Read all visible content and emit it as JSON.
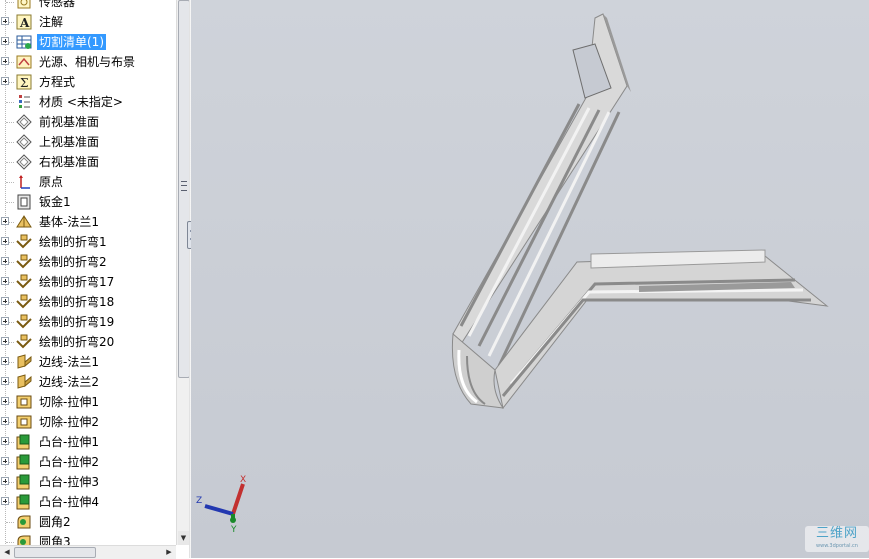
{
  "feature_tree": {
    "items": [
      {
        "label": "传感器",
        "icon": "sensor-icon",
        "expandable": false
      },
      {
        "label": "注解",
        "icon": "annotation-icon",
        "expandable": true
      },
      {
        "label": "切割清单(1)",
        "icon": "cut-list-icon",
        "expandable": true,
        "selected": true
      },
      {
        "label": "光源、相机与布景",
        "icon": "lights-cameras-icon",
        "expandable": true
      },
      {
        "label": "方程式",
        "icon": "equations-icon",
        "expandable": true
      },
      {
        "label": "材质 <未指定>",
        "icon": "material-icon",
        "expandable": false
      },
      {
        "label": "前视基准面",
        "icon": "plane-icon",
        "expandable": false
      },
      {
        "label": "上视基准面",
        "icon": "plane-icon",
        "expandable": false
      },
      {
        "label": "右视基准面",
        "icon": "plane-icon",
        "expandable": false
      },
      {
        "label": "原点",
        "icon": "origin-icon",
        "expandable": false
      },
      {
        "label": "钣金1",
        "icon": "sheet-metal-icon",
        "expandable": false
      },
      {
        "label": "基体-法兰1",
        "icon": "base-flange-icon",
        "expandable": true
      },
      {
        "label": "绘制的折弯1",
        "icon": "sketched-bend-icon",
        "expandable": true
      },
      {
        "label": "绘制的折弯2",
        "icon": "sketched-bend-icon",
        "expandable": true
      },
      {
        "label": "绘制的折弯17",
        "icon": "sketched-bend-icon",
        "expandable": true
      },
      {
        "label": "绘制的折弯18",
        "icon": "sketched-bend-icon",
        "expandable": true
      },
      {
        "label": "绘制的折弯19",
        "icon": "sketched-bend-icon",
        "expandable": true
      },
      {
        "label": "绘制的折弯20",
        "icon": "sketched-bend-icon",
        "expandable": true
      },
      {
        "label": "边线-法兰1",
        "icon": "edge-flange-icon",
        "expandable": true
      },
      {
        "label": "边线-法兰2",
        "icon": "edge-flange-icon",
        "expandable": true
      },
      {
        "label": "切除-拉伸1",
        "icon": "cut-extrude-icon",
        "expandable": true
      },
      {
        "label": "切除-拉伸2",
        "icon": "cut-extrude-icon",
        "expandable": true
      },
      {
        "label": "凸台-拉伸1",
        "icon": "boss-extrude-icon",
        "expandable": true
      },
      {
        "label": "凸台-拉伸2",
        "icon": "boss-extrude-icon",
        "expandable": true
      },
      {
        "label": "凸台-拉伸3",
        "icon": "boss-extrude-icon",
        "expandable": true
      },
      {
        "label": "凸台-拉伸4",
        "icon": "boss-extrude-icon",
        "expandable": true
      },
      {
        "label": "圆角2",
        "icon": "fillet-icon",
        "expandable": false
      },
      {
        "label": "圆角3",
        "icon": "fillet-icon",
        "expandable": false
      }
    ]
  },
  "triad": {
    "x_label": "X",
    "y_label": "Y",
    "z_label": "Z"
  },
  "watermark": {
    "text": "三维网",
    "url": "www.3dportal.cn"
  },
  "colors": {
    "selection": "#3399ff",
    "viewport_bg": "#c8ccd4",
    "part_face": "#dcdcdc",
    "part_shadow": "#8e8e8e"
  }
}
